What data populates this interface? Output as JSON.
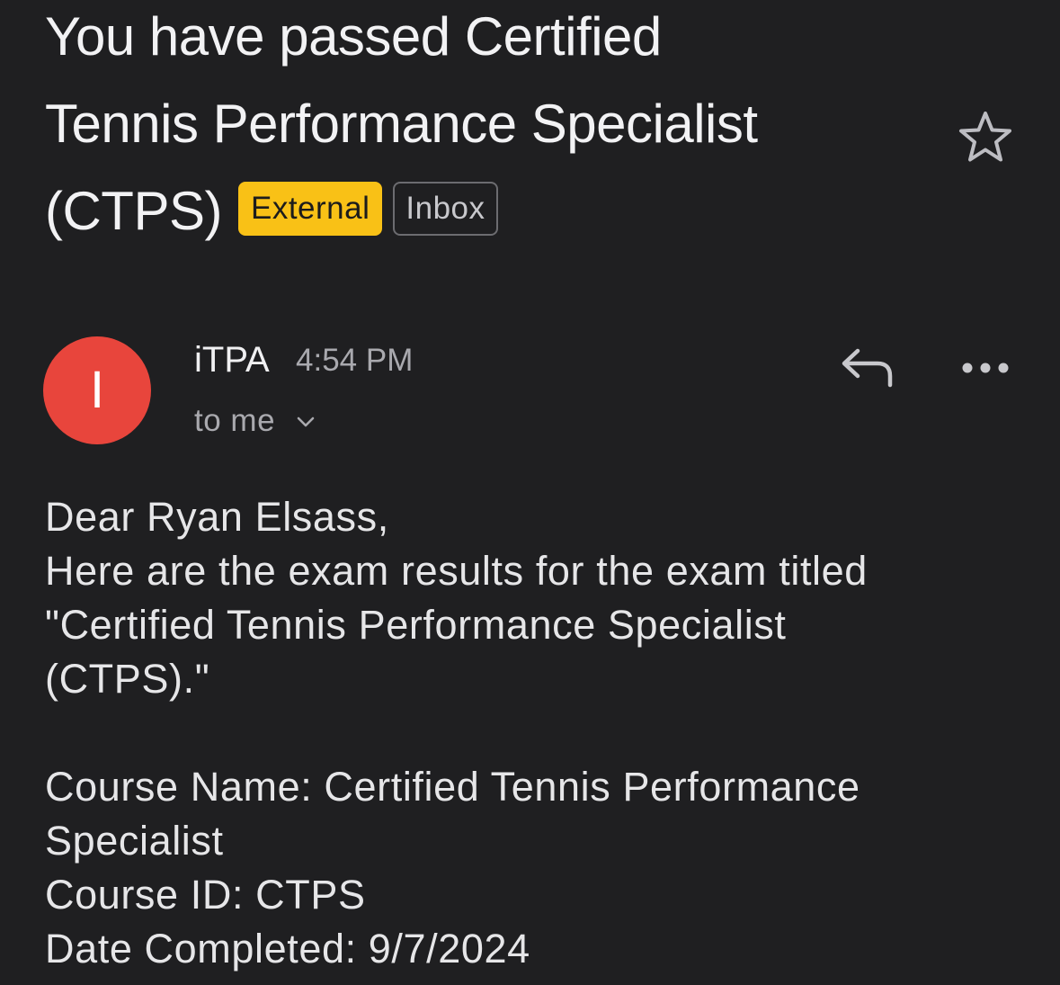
{
  "email": {
    "subject": "You have passed Certified\nTennis Performance Specialist\n(CTPS)",
    "labels": {
      "external": "External",
      "inbox": "Inbox"
    },
    "star_icon": "star-outline-icon",
    "sender": {
      "avatar_initial": "I",
      "avatar_color": "#e8453c",
      "name": "iTPA",
      "time": "4:54 PM",
      "recipient": "to me"
    },
    "actions": {
      "reply_icon": "reply-icon",
      "more_icon": "more-horizontal-icon"
    },
    "body": {
      "greeting": "Dear Ryan Elsass,",
      "intro_line1": "Here are the exam results for the exam titled",
      "intro_line2": "\"Certified Tennis Performance Specialist",
      "intro_line3": "(CTPS).\"",
      "course_name_line1": "Course Name: Certified Tennis Performance",
      "course_name_line2": "Specialist",
      "course_id": "Course ID: CTPS",
      "date_completed": "Date Completed: 9/7/2024"
    }
  },
  "colors": {
    "background": "#1f1f21",
    "external_label": "#f9c116"
  }
}
